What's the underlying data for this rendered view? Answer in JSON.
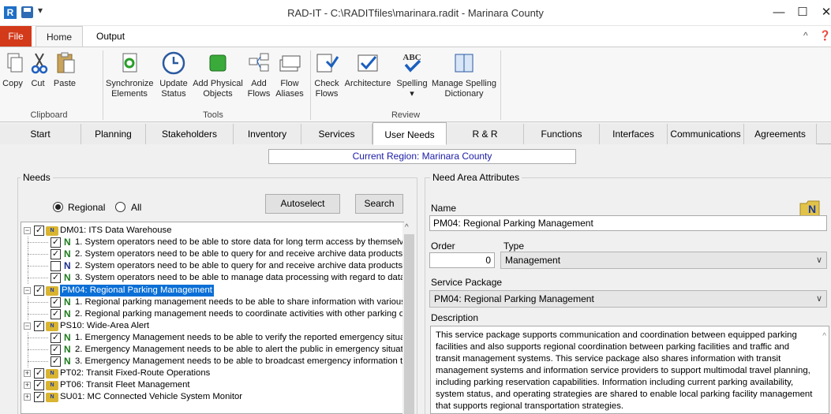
{
  "window": {
    "title": "RAD-IT - C:\\RADITfiles\\marinara.radit - Marinara County",
    "app_icon": "R",
    "qat_dropdown": "▾",
    "minimize": "—",
    "maximize": "☐",
    "close": "✕"
  },
  "menu": {
    "file": "File",
    "home": "Home",
    "output": "Output",
    "collapse": "^",
    "help": "❓"
  },
  "ribbon": {
    "buttons": [
      {
        "label": "Copy",
        "icon": "copy-icon"
      },
      {
        "label": "Cut",
        "icon": "scissors-icon"
      },
      {
        "label": "Paste",
        "icon": "paste-icon"
      },
      {
        "label": "Synchronize\nElements",
        "icon": "sync-icon"
      },
      {
        "label": "Update\nStatus",
        "icon": "clock-icon"
      },
      {
        "label": "Add Physical\nObjects",
        "icon": "green-cube-icon"
      },
      {
        "label": "Add\nFlows",
        "icon": "add-flows-icon"
      },
      {
        "label": "Flow\nAliases",
        "icon": "flow-aliases-icon"
      },
      {
        "label": "Check\nFlows",
        "icon": "check-flows-icon"
      },
      {
        "label": "Architecture",
        "icon": "architecture-icon"
      },
      {
        "label": "Spelling\n▾",
        "icon": "spelling-abc-icon"
      },
      {
        "label": "Manage Spelling\nDictionary",
        "icon": "dictionary-icon"
      }
    ],
    "groups": {
      "clipboard": "Clipboard",
      "tools": "Tools",
      "review": "Review"
    }
  },
  "tabs": [
    "Start",
    "Planning",
    "Stakeholders",
    "Inventory",
    "Services",
    "User Needs",
    "R & R",
    "Functions",
    "Interfaces",
    "Communications",
    "Agreements"
  ],
  "active_tab": "User Needs",
  "region": "Current Region: Marinara County",
  "needs": {
    "group_label": "Needs",
    "radio_regional": "Regional",
    "radio_all": "All",
    "autoselect": "Autoselect",
    "search": "Search",
    "tree": [
      {
        "level": 0,
        "text": "DM01: ITS Data Warehouse",
        "checked": true,
        "expanded": true
      },
      {
        "level": 1,
        "text": "1. System operators need to be able to store data for long term access by themselv",
        "checked": true
      },
      {
        "level": 1,
        "text": "2. System operators need to be able to query for and receive archive data products",
        "checked": true
      },
      {
        "level": 1,
        "text": "2. System operators need to be able to query for and receive archive data products",
        "checked": false
      },
      {
        "level": 1,
        "text": "3. System operators need to be able to manage data processing with regard to data",
        "checked": true
      },
      {
        "level": 0,
        "text": "PM04: Regional Parking Management",
        "checked": true,
        "expanded": true,
        "selected": true
      },
      {
        "level": 1,
        "text": "1. Regional parking management needs to be able to share information with various",
        "checked": true
      },
      {
        "level": 1,
        "text": "2. Regional parking management needs to coordinate activities with other parking op",
        "checked": true
      },
      {
        "level": 0,
        "text": "PS10: Wide-Area Alert",
        "checked": true,
        "expanded": true
      },
      {
        "level": 1,
        "text": "1. Emergency Management needs to be able to verify the reported emergency situat",
        "checked": true
      },
      {
        "level": 1,
        "text": "2. Emergency Management needs to be able to alert the public in emergency situatio",
        "checked": true
      },
      {
        "level": 1,
        "text": "3. Emergency Management needs to be able to broadcast emergency information to",
        "checked": true
      },
      {
        "level": 0,
        "text": "PT02: Transit Fixed-Route Operations",
        "checked": true,
        "expanded": false
      },
      {
        "level": 0,
        "text": "PT06: Transit Fleet Management",
        "checked": true,
        "expanded": false
      },
      {
        "level": 0,
        "text": "SU01: MC Connected Vehicle System Monitor",
        "checked": true,
        "expanded": false
      }
    ]
  },
  "attributes": {
    "group_label": "Need Area Attributes",
    "name_label": "Name",
    "name_value": "PM04: Regional Parking Management",
    "order_label": "Order",
    "order_value": "0",
    "type_label": "Type",
    "type_value": "Management",
    "service_package_label": "Service Package",
    "service_package_value": "PM04: Regional Parking Management",
    "description_label": "Description",
    "description": "This service package supports communication and coordination between equipped parking facilities and also supports regional coordination between parking facilities and traffic and transit management systems. This service package also shares information with transit management systems and information service providers to support multimodal travel planning, including parking reservation capabilities. Information including current parking availability, system status, and operating strategies are shared to enable local parking facility management that supports regional transportation strategies.",
    "new_icon_letter": "N"
  }
}
